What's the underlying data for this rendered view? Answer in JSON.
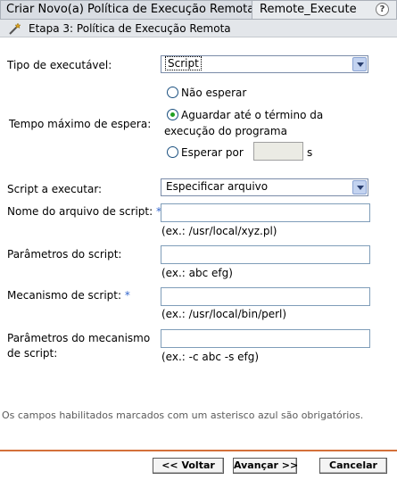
{
  "window": {
    "title": "Criar Novo(a) Política de Execução Remota",
    "tab_name": "Remote_Execute",
    "help": "?"
  },
  "step": {
    "title": "Etapa 3: Política de Execução Remota"
  },
  "executable_type": {
    "label": "Tipo de executável:",
    "selected": "Script"
  },
  "wait": {
    "label": "Tempo máximo de espera:",
    "options": [
      {
        "label": "Não esperar",
        "checked": false
      },
      {
        "label": "Aguardar até o término da",
        "label_cont": "execução do programa",
        "checked": true
      },
      {
        "label": "Esperar por",
        "checked": false
      }
    ],
    "unit": "s",
    "seconds_value": ""
  },
  "script_to_run": {
    "label": "Script a executar:",
    "selected": "Especificar arquivo"
  },
  "script_file": {
    "label": "Nome do arquivo de script:",
    "required_mark": "*",
    "value": "",
    "example": "(ex.: /usr/local/xyz.pl)"
  },
  "script_params": {
    "label": "Parâmetros do script:",
    "value": "",
    "example": "(ex.: abc efg)"
  },
  "script_engine": {
    "label": "Mecanismo de script:",
    "required_mark": "*",
    "value": "",
    "example": "(ex.: /usr/local/bin/perl)"
  },
  "engine_params": {
    "label_line1": "Parâmetros do mecanismo",
    "label_line2": "de script:",
    "value": "",
    "example": "(ex.: -c abc -s efg)"
  },
  "footer": {
    "note": "Os campos habilitados marcados com um asterisco azul são obrigatórios."
  },
  "buttons": {
    "back": "<< Voltar",
    "next": "Avançar >>",
    "cancel": "Cancelar"
  },
  "colors": {
    "accent_divider": "#d4703a",
    "required_asterisk": "#3366cc"
  }
}
